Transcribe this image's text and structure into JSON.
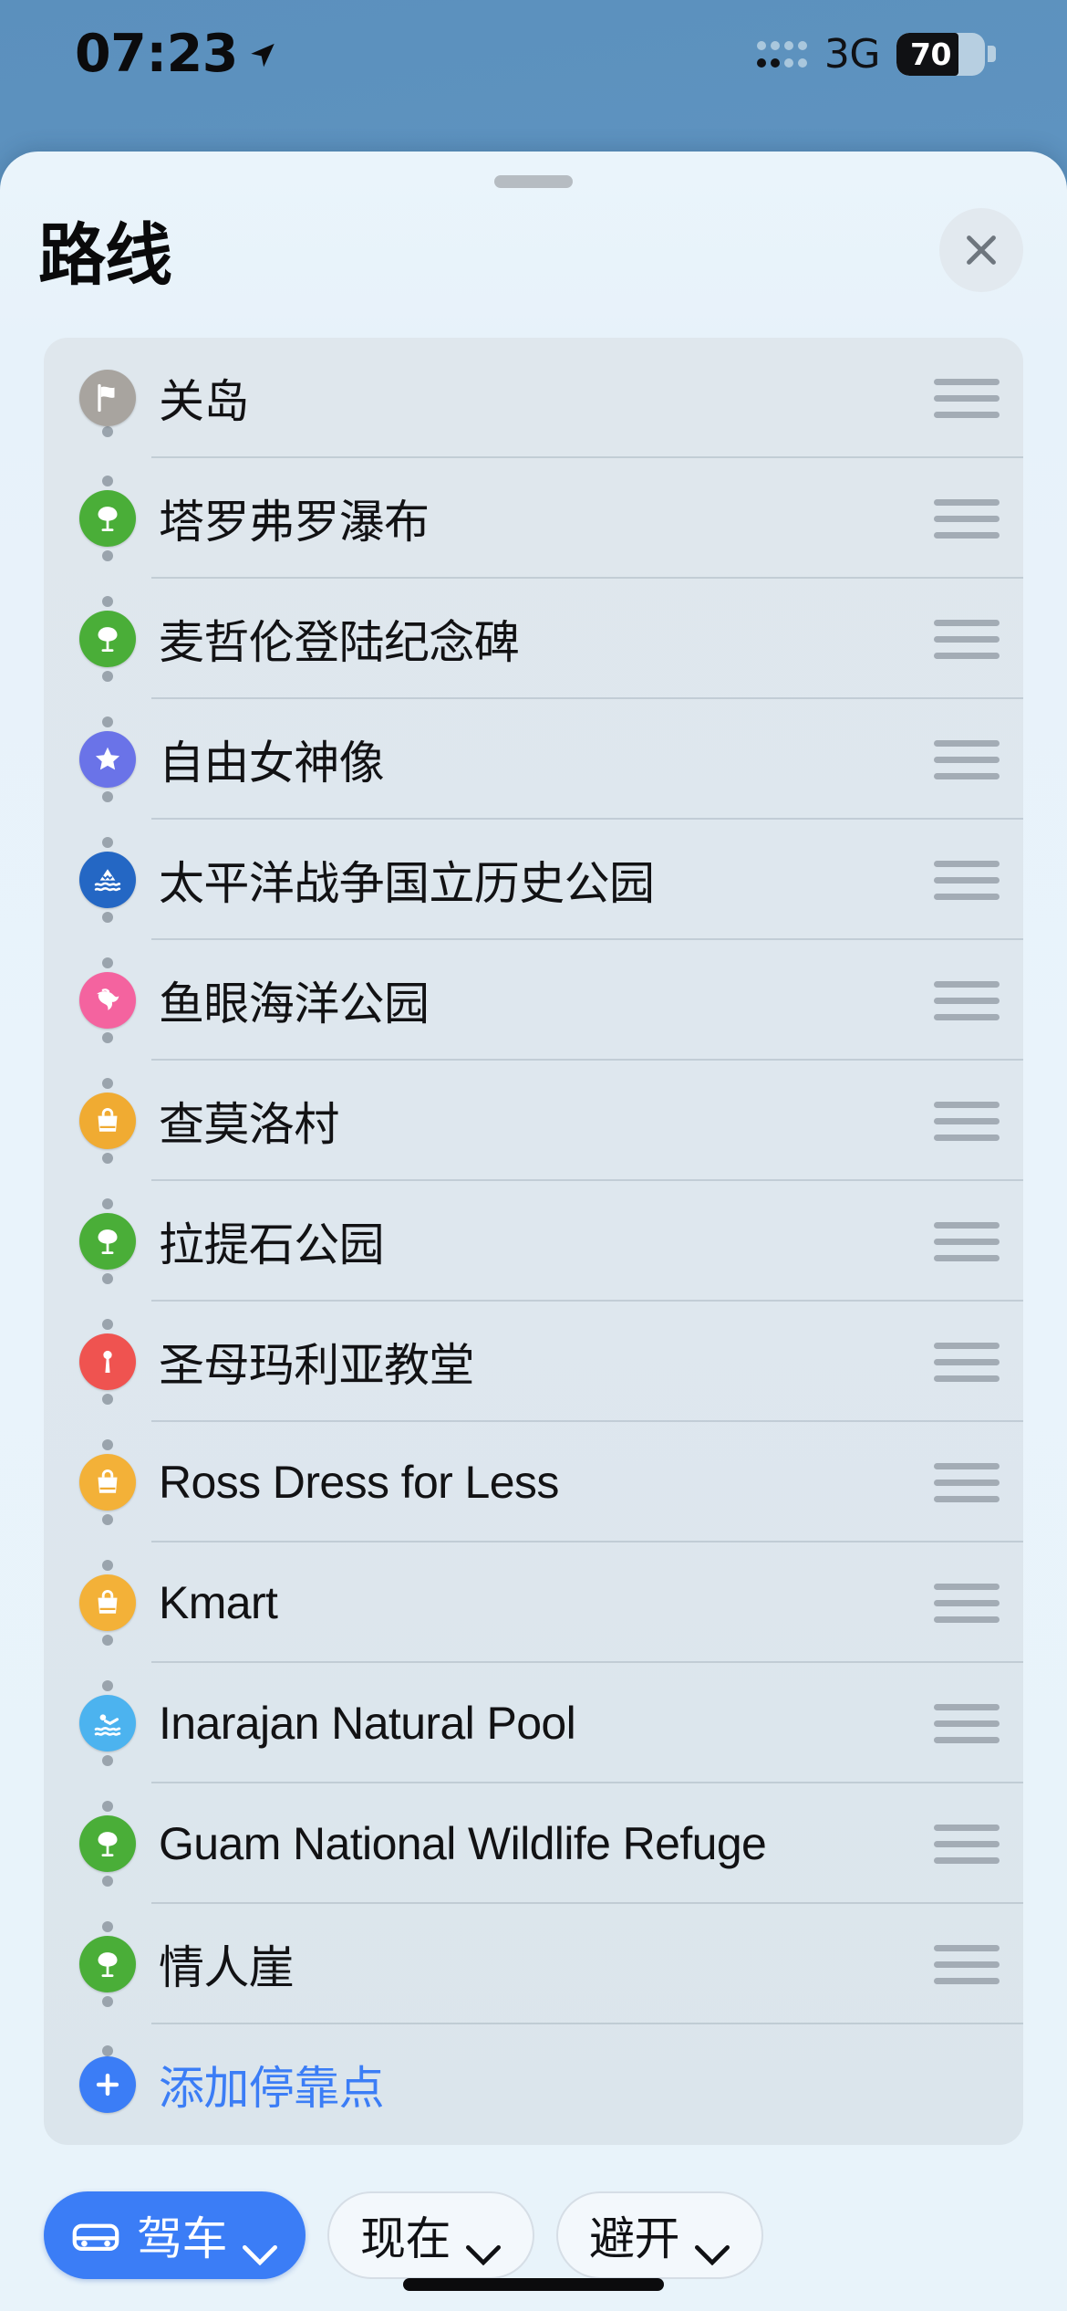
{
  "status_bar": {
    "time": "07:23",
    "location_arrow_icon": "location-arrow-icon",
    "signal_icon": "signal-dots-icon",
    "signal_dots_active": 2,
    "signal_dots_total": 8,
    "network": "3G",
    "battery_percent": "70",
    "battery_level": 70
  },
  "sheet": {
    "grabber_icon": "sheet-grabber",
    "title": "路线",
    "close_icon": "close-icon",
    "close_label": ""
  },
  "stops": [
    {
      "label": "关岛",
      "icon": "flag-icon",
      "color": "#a8a49f"
    },
    {
      "label": "塔罗弗罗瀑布",
      "icon": "tree-icon",
      "color": "#4aae38"
    },
    {
      "label": "麦哲伦登陆纪念碑",
      "icon": "tree-icon",
      "color": "#4aae38"
    },
    {
      "label": "自由女神像",
      "icon": "star-icon",
      "color": "#6a73e8"
    },
    {
      "label": "太平洋战争国立历史公园",
      "icon": "national-park-icon",
      "color": "#2467c4"
    },
    {
      "label": "鱼眼海洋公园",
      "icon": "dolphin-icon",
      "color": "#f4639f"
    },
    {
      "label": "查莫洛村",
      "icon": "shopping-bag-icon",
      "color": "#f0ab32"
    },
    {
      "label": "拉提石公园",
      "icon": "tree-icon",
      "color": "#4aae38"
    },
    {
      "label": "圣母玛利亚教堂",
      "icon": "landmark-pin-icon",
      "color": "#ef5350"
    },
    {
      "label": "Ross Dress for Less",
      "icon": "shopping-bag-icon",
      "color": "#f3b138"
    },
    {
      "label": "Kmart",
      "icon": "shopping-bag-icon",
      "color": "#f3b138"
    },
    {
      "label": "Inarajan Natural Pool",
      "icon": "swimming-icon",
      "color": "#4cb3ef"
    },
    {
      "label": "Guam National Wildlife Refuge",
      "icon": "tree-icon",
      "color": "#4aae38"
    },
    {
      "label": "情人崖",
      "icon": "tree-icon",
      "color": "#4aae38"
    }
  ],
  "add_stop": {
    "label": "添加停靠点",
    "icon": "plus-circle-icon",
    "color": "#3b7df6"
  },
  "reorder_handle_icon": "reorder-handle-icon",
  "bottom_bar": {
    "mode": {
      "label": "驾车",
      "icon": "car-icon",
      "chevron": "chevron-down-icon",
      "active": true
    },
    "time": {
      "label": "现在",
      "chevron": "chevron-down-icon"
    },
    "avoid": {
      "label": "避开",
      "chevron": "chevron-down-icon"
    }
  },
  "colors": {
    "accent": "#3b7df6",
    "sheet_bg": "#e8f3fa",
    "card_bg": "#dee7ee",
    "map_blue": "#669ac6"
  },
  "home_indicator_icon": "home-indicator"
}
